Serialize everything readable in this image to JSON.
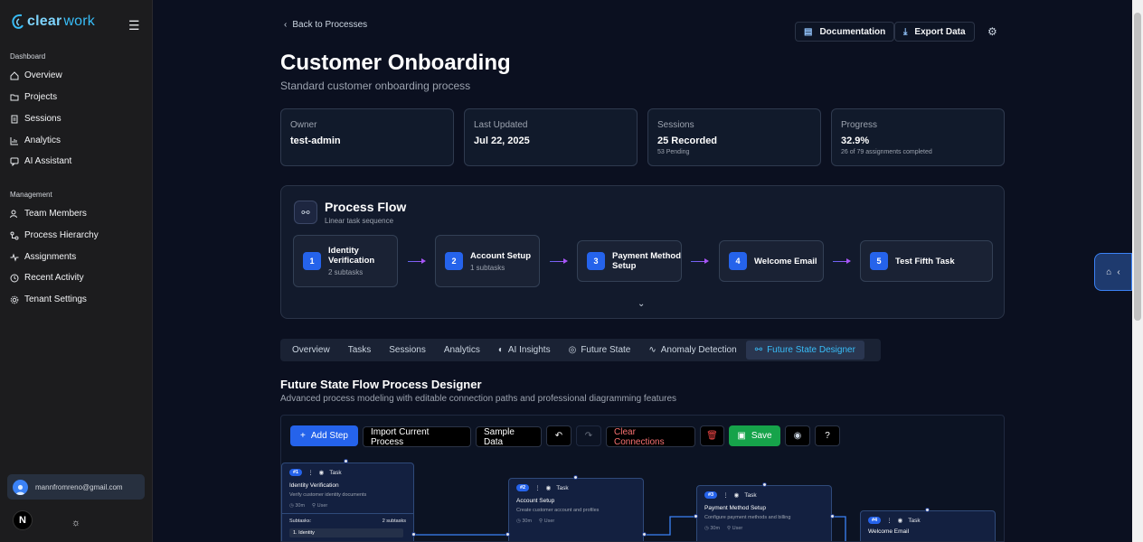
{
  "app": {
    "logo_a": "clear",
    "logo_b": "work"
  },
  "sidebar": {
    "section1": "Dashboard",
    "items1": [
      "Overview",
      "Projects",
      "Sessions",
      "Analytics",
      "AI Assistant"
    ],
    "section2": "Management",
    "items2": [
      "Team Members",
      "Process Hierarchy",
      "Assignments",
      "Recent Activity",
      "Tenant Settings"
    ],
    "user_email": "mannfromreno@gmail.com",
    "avatar_letter": "N"
  },
  "header": {
    "back": "Back to Processes",
    "documentation": "Documentation",
    "export": "Export Data",
    "title": "Customer Onboarding",
    "subtitle": "Standard customer onboarding process"
  },
  "cards": [
    {
      "label": "Owner",
      "value": "test-admin",
      "small": ""
    },
    {
      "label": "Last Updated",
      "value": "Jul 22, 2025",
      "small": ""
    },
    {
      "label": "Sessions",
      "value": "25 Recorded",
      "small": "53 Pending"
    },
    {
      "label": "Progress",
      "value": "32.9%",
      "small": "26 of 79 assignments completed"
    }
  ],
  "process_flow": {
    "title": "Process Flow",
    "subtitle": "Linear task sequence",
    "steps": [
      {
        "num": "1",
        "title": "Identity Verification",
        "sub": "2 subtasks"
      },
      {
        "num": "2",
        "title": "Account Setup",
        "sub": "1 subtasks"
      },
      {
        "num": "3",
        "title": "Payment Method Setup",
        "sub": ""
      },
      {
        "num": "4",
        "title": "Welcome Email",
        "sub": ""
      },
      {
        "num": "5",
        "title": "Test Fifth Task",
        "sub": ""
      }
    ]
  },
  "tabs": [
    "Overview",
    "Tasks",
    "Sessions",
    "Analytics",
    "AI Insights",
    "Future State",
    "Anomaly Detection",
    "Future State Designer"
  ],
  "designer": {
    "title": "Future State Flow Process Designer",
    "subtitle": "Advanced process modeling with editable connection paths and professional diagramming features",
    "add_step": "Add Step",
    "import": "Import Current Process",
    "sample": "Sample Data",
    "clear": "Clear Connections",
    "save": "Save",
    "nodes": [
      {
        "badge": "#1",
        "type": "Task",
        "title": "Identity Verification",
        "desc": "Verify customer identity documents",
        "time": "30m",
        "role": "User",
        "subtasks_label": "Subtasks:",
        "subtasks_count": "2 subtasks",
        "first_sub": "1. Identity"
      },
      {
        "badge": "#2",
        "type": "Task",
        "title": "Account Setup",
        "desc": "Create customer account and profiles",
        "time": "30m",
        "role": "User"
      },
      {
        "badge": "#3",
        "type": "Task",
        "title": "Payment Method Setup",
        "desc": "Configure payment methods and billing",
        "time": "30m",
        "role": "User"
      },
      {
        "badge": "#4",
        "type": "Task",
        "title": "Welcome Email",
        "desc": "",
        "time": "",
        "role": ""
      }
    ]
  }
}
